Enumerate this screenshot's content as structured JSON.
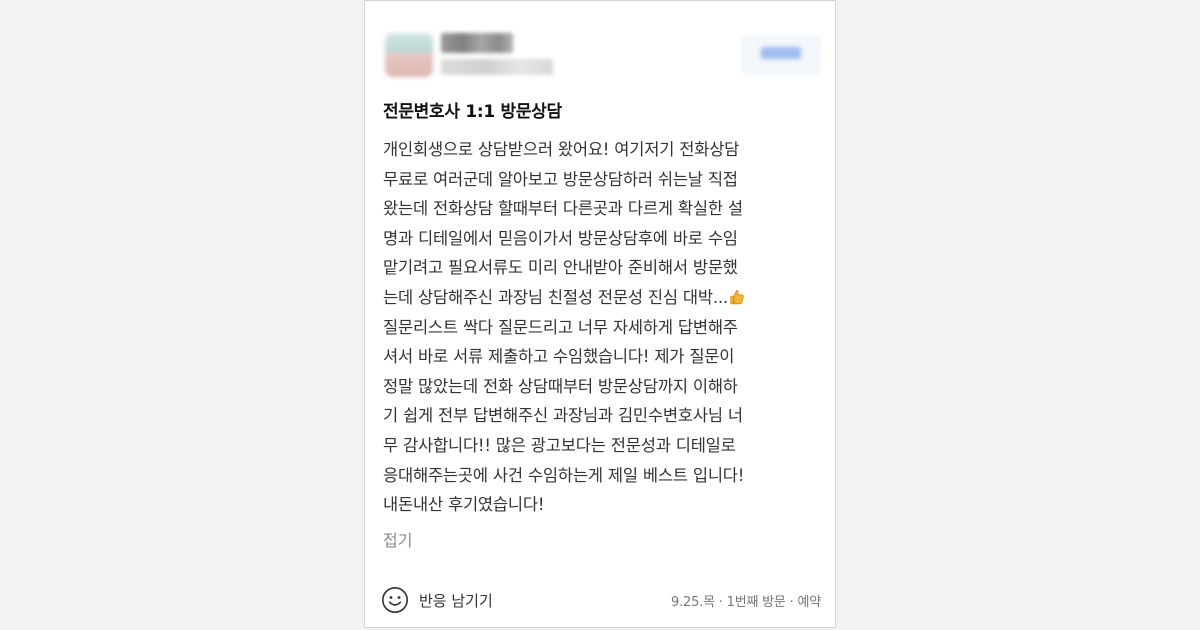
{
  "review": {
    "title": "전문변호사 1:1 방문상담",
    "lines": [
      "개인회생으로 상담받으러 왔어요! 여기저기 전화상담",
      "무료로 여러군데 알아보고 방문상담하러 쉬는날 직접",
      "왔는데 전화상담 할때부터 다른곳과 다르게 확실한 설",
      "명과 디테일에서 믿음이가서 방문상담후에 바로 수임",
      "맡기려고 필요서류도 미리 안내받아 준비해서 방문했",
      "는데 상담해주신 과장님 친절성 전문성 진심 대박...",
      "질문리스트 싹다 질문드리고 너무 자세하게 답변해주",
      "셔서 바로 서류 제출하고 수임했습니다! 제가 질문이",
      "정말 많았는데 전화 상담때부터 방문상담까지 이해하",
      "기 쉽게 전부 답변해주신 과장님과 김민수변호사님 너",
      "무 감사합니다!! 많은 광고보다는 전문성과 디테일로",
      "응대해주는곳에 사건 수임하는게 제일 베스트 입니다!",
      "내돈내산 후기였습니다!"
    ],
    "emoji_icon": "thumbs-up-icon",
    "collapse_label": "접기"
  },
  "footer": {
    "react_icon": "smile-icon",
    "react_label": "반응 남기기",
    "visit_info": "9.25.목 · 1번째 방문 · 예약"
  },
  "colors": {
    "background": "#f2f2f2",
    "card": "#ffffff",
    "title_text": "#111111",
    "body_text": "#333333",
    "muted_text": "#8a8a8a"
  }
}
